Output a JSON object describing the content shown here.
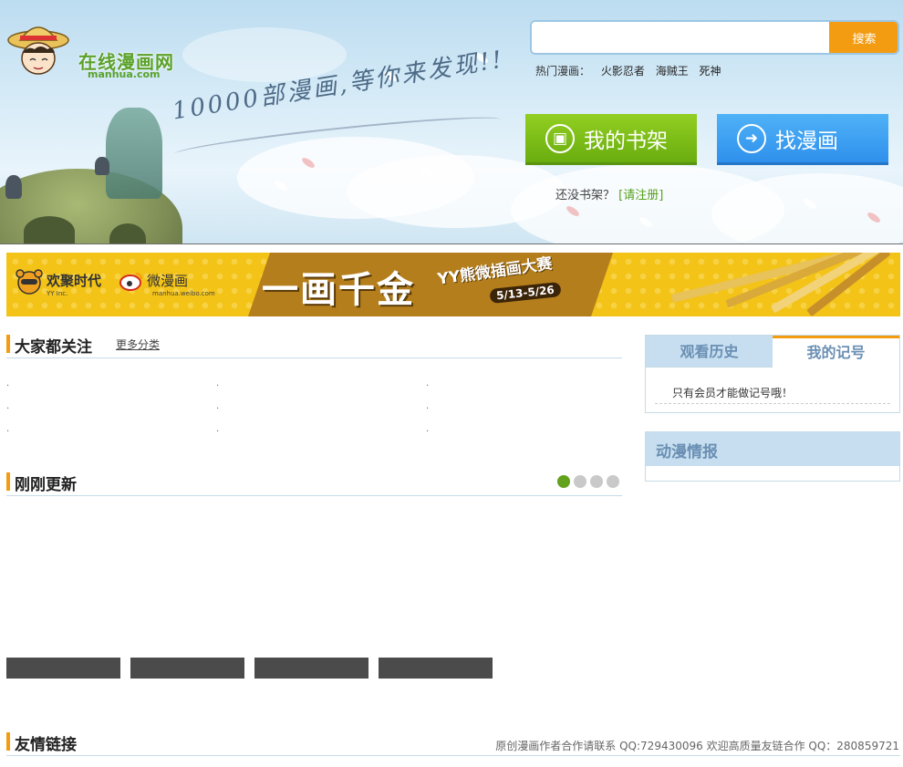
{
  "header": {
    "logo_cn": "在线漫画网",
    "logo_en": "manhua.com",
    "slogan": "10000部漫画,等你来发现!!",
    "search": {
      "placeholder": "",
      "button": "搜索"
    },
    "hot": {
      "label": "热门漫画：",
      "items": [
        "火影忍者",
        "海贼王",
        "死神"
      ]
    },
    "btn_shelf": "我的书架",
    "btn_find": "找漫画",
    "register_prompt": "还没书架？",
    "register_link": "[请注册]"
  },
  "banner": {
    "brand1": "欢聚时代",
    "brand1_sub": "YY Inc.",
    "brand2": "微漫画",
    "brand2_sub": "manhua.weibo.com",
    "title": "一画千金",
    "subtitle": "YY熊微插画大赛",
    "date": "5/13-5/26"
  },
  "sections": {
    "popular": {
      "title": "大家都关注",
      "more": "更多分类"
    },
    "updated": {
      "title": "刚刚更新",
      "pager_count": 4,
      "pager_active": 0
    },
    "links": {
      "title": "友情链接",
      "note": "原创漫画作者合作请联系 QQ:729430096 欢迎高质量友链合作 QQ：280859721"
    }
  },
  "sidebar": {
    "tab_history": "观看历史",
    "tab_mine": "我的记号",
    "member_msg": "只有会员才能做记号哦！",
    "news_title": "动漫情报"
  },
  "colors": {
    "accent_orange": "#f39c12",
    "green": "#69ad0f",
    "blue": "#2f90ec",
    "tab_bg": "#c6def0"
  }
}
